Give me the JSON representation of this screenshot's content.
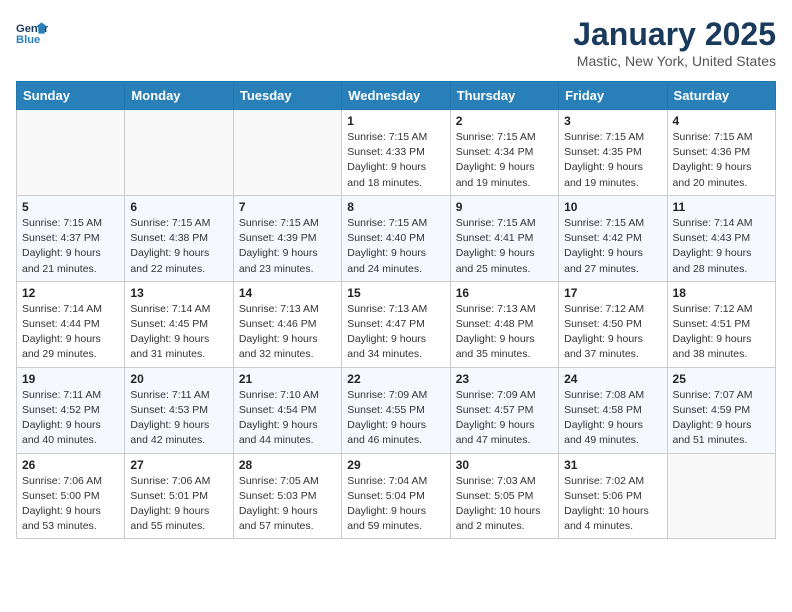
{
  "header": {
    "logo_line1": "General",
    "logo_line2": "Blue",
    "month": "January 2025",
    "location": "Mastic, New York, United States"
  },
  "weekdays": [
    "Sunday",
    "Monday",
    "Tuesday",
    "Wednesday",
    "Thursday",
    "Friday",
    "Saturday"
  ],
  "weeks": [
    [
      {
        "day": "",
        "info": ""
      },
      {
        "day": "",
        "info": ""
      },
      {
        "day": "",
        "info": ""
      },
      {
        "day": "1",
        "info": "Sunrise: 7:15 AM\nSunset: 4:33 PM\nDaylight: 9 hours\nand 18 minutes."
      },
      {
        "day": "2",
        "info": "Sunrise: 7:15 AM\nSunset: 4:34 PM\nDaylight: 9 hours\nand 19 minutes."
      },
      {
        "day": "3",
        "info": "Sunrise: 7:15 AM\nSunset: 4:35 PM\nDaylight: 9 hours\nand 19 minutes."
      },
      {
        "day": "4",
        "info": "Sunrise: 7:15 AM\nSunset: 4:36 PM\nDaylight: 9 hours\nand 20 minutes."
      }
    ],
    [
      {
        "day": "5",
        "info": "Sunrise: 7:15 AM\nSunset: 4:37 PM\nDaylight: 9 hours\nand 21 minutes."
      },
      {
        "day": "6",
        "info": "Sunrise: 7:15 AM\nSunset: 4:38 PM\nDaylight: 9 hours\nand 22 minutes."
      },
      {
        "day": "7",
        "info": "Sunrise: 7:15 AM\nSunset: 4:39 PM\nDaylight: 9 hours\nand 23 minutes."
      },
      {
        "day": "8",
        "info": "Sunrise: 7:15 AM\nSunset: 4:40 PM\nDaylight: 9 hours\nand 24 minutes."
      },
      {
        "day": "9",
        "info": "Sunrise: 7:15 AM\nSunset: 4:41 PM\nDaylight: 9 hours\nand 25 minutes."
      },
      {
        "day": "10",
        "info": "Sunrise: 7:15 AM\nSunset: 4:42 PM\nDaylight: 9 hours\nand 27 minutes."
      },
      {
        "day": "11",
        "info": "Sunrise: 7:14 AM\nSunset: 4:43 PM\nDaylight: 9 hours\nand 28 minutes."
      }
    ],
    [
      {
        "day": "12",
        "info": "Sunrise: 7:14 AM\nSunset: 4:44 PM\nDaylight: 9 hours\nand 29 minutes."
      },
      {
        "day": "13",
        "info": "Sunrise: 7:14 AM\nSunset: 4:45 PM\nDaylight: 9 hours\nand 31 minutes."
      },
      {
        "day": "14",
        "info": "Sunrise: 7:13 AM\nSunset: 4:46 PM\nDaylight: 9 hours\nand 32 minutes."
      },
      {
        "day": "15",
        "info": "Sunrise: 7:13 AM\nSunset: 4:47 PM\nDaylight: 9 hours\nand 34 minutes."
      },
      {
        "day": "16",
        "info": "Sunrise: 7:13 AM\nSunset: 4:48 PM\nDaylight: 9 hours\nand 35 minutes."
      },
      {
        "day": "17",
        "info": "Sunrise: 7:12 AM\nSunset: 4:50 PM\nDaylight: 9 hours\nand 37 minutes."
      },
      {
        "day": "18",
        "info": "Sunrise: 7:12 AM\nSunset: 4:51 PM\nDaylight: 9 hours\nand 38 minutes."
      }
    ],
    [
      {
        "day": "19",
        "info": "Sunrise: 7:11 AM\nSunset: 4:52 PM\nDaylight: 9 hours\nand 40 minutes."
      },
      {
        "day": "20",
        "info": "Sunrise: 7:11 AM\nSunset: 4:53 PM\nDaylight: 9 hours\nand 42 minutes."
      },
      {
        "day": "21",
        "info": "Sunrise: 7:10 AM\nSunset: 4:54 PM\nDaylight: 9 hours\nand 44 minutes."
      },
      {
        "day": "22",
        "info": "Sunrise: 7:09 AM\nSunset: 4:55 PM\nDaylight: 9 hours\nand 46 minutes."
      },
      {
        "day": "23",
        "info": "Sunrise: 7:09 AM\nSunset: 4:57 PM\nDaylight: 9 hours\nand 47 minutes."
      },
      {
        "day": "24",
        "info": "Sunrise: 7:08 AM\nSunset: 4:58 PM\nDaylight: 9 hours\nand 49 minutes."
      },
      {
        "day": "25",
        "info": "Sunrise: 7:07 AM\nSunset: 4:59 PM\nDaylight: 9 hours\nand 51 minutes."
      }
    ],
    [
      {
        "day": "26",
        "info": "Sunrise: 7:06 AM\nSunset: 5:00 PM\nDaylight: 9 hours\nand 53 minutes."
      },
      {
        "day": "27",
        "info": "Sunrise: 7:06 AM\nSunset: 5:01 PM\nDaylight: 9 hours\nand 55 minutes."
      },
      {
        "day": "28",
        "info": "Sunrise: 7:05 AM\nSunset: 5:03 PM\nDaylight: 9 hours\nand 57 minutes."
      },
      {
        "day": "29",
        "info": "Sunrise: 7:04 AM\nSunset: 5:04 PM\nDaylight: 9 hours\nand 59 minutes."
      },
      {
        "day": "30",
        "info": "Sunrise: 7:03 AM\nSunset: 5:05 PM\nDaylight: 10 hours\nand 2 minutes."
      },
      {
        "day": "31",
        "info": "Sunrise: 7:02 AM\nSunset: 5:06 PM\nDaylight: 10 hours\nand 4 minutes."
      },
      {
        "day": "",
        "info": ""
      }
    ]
  ]
}
